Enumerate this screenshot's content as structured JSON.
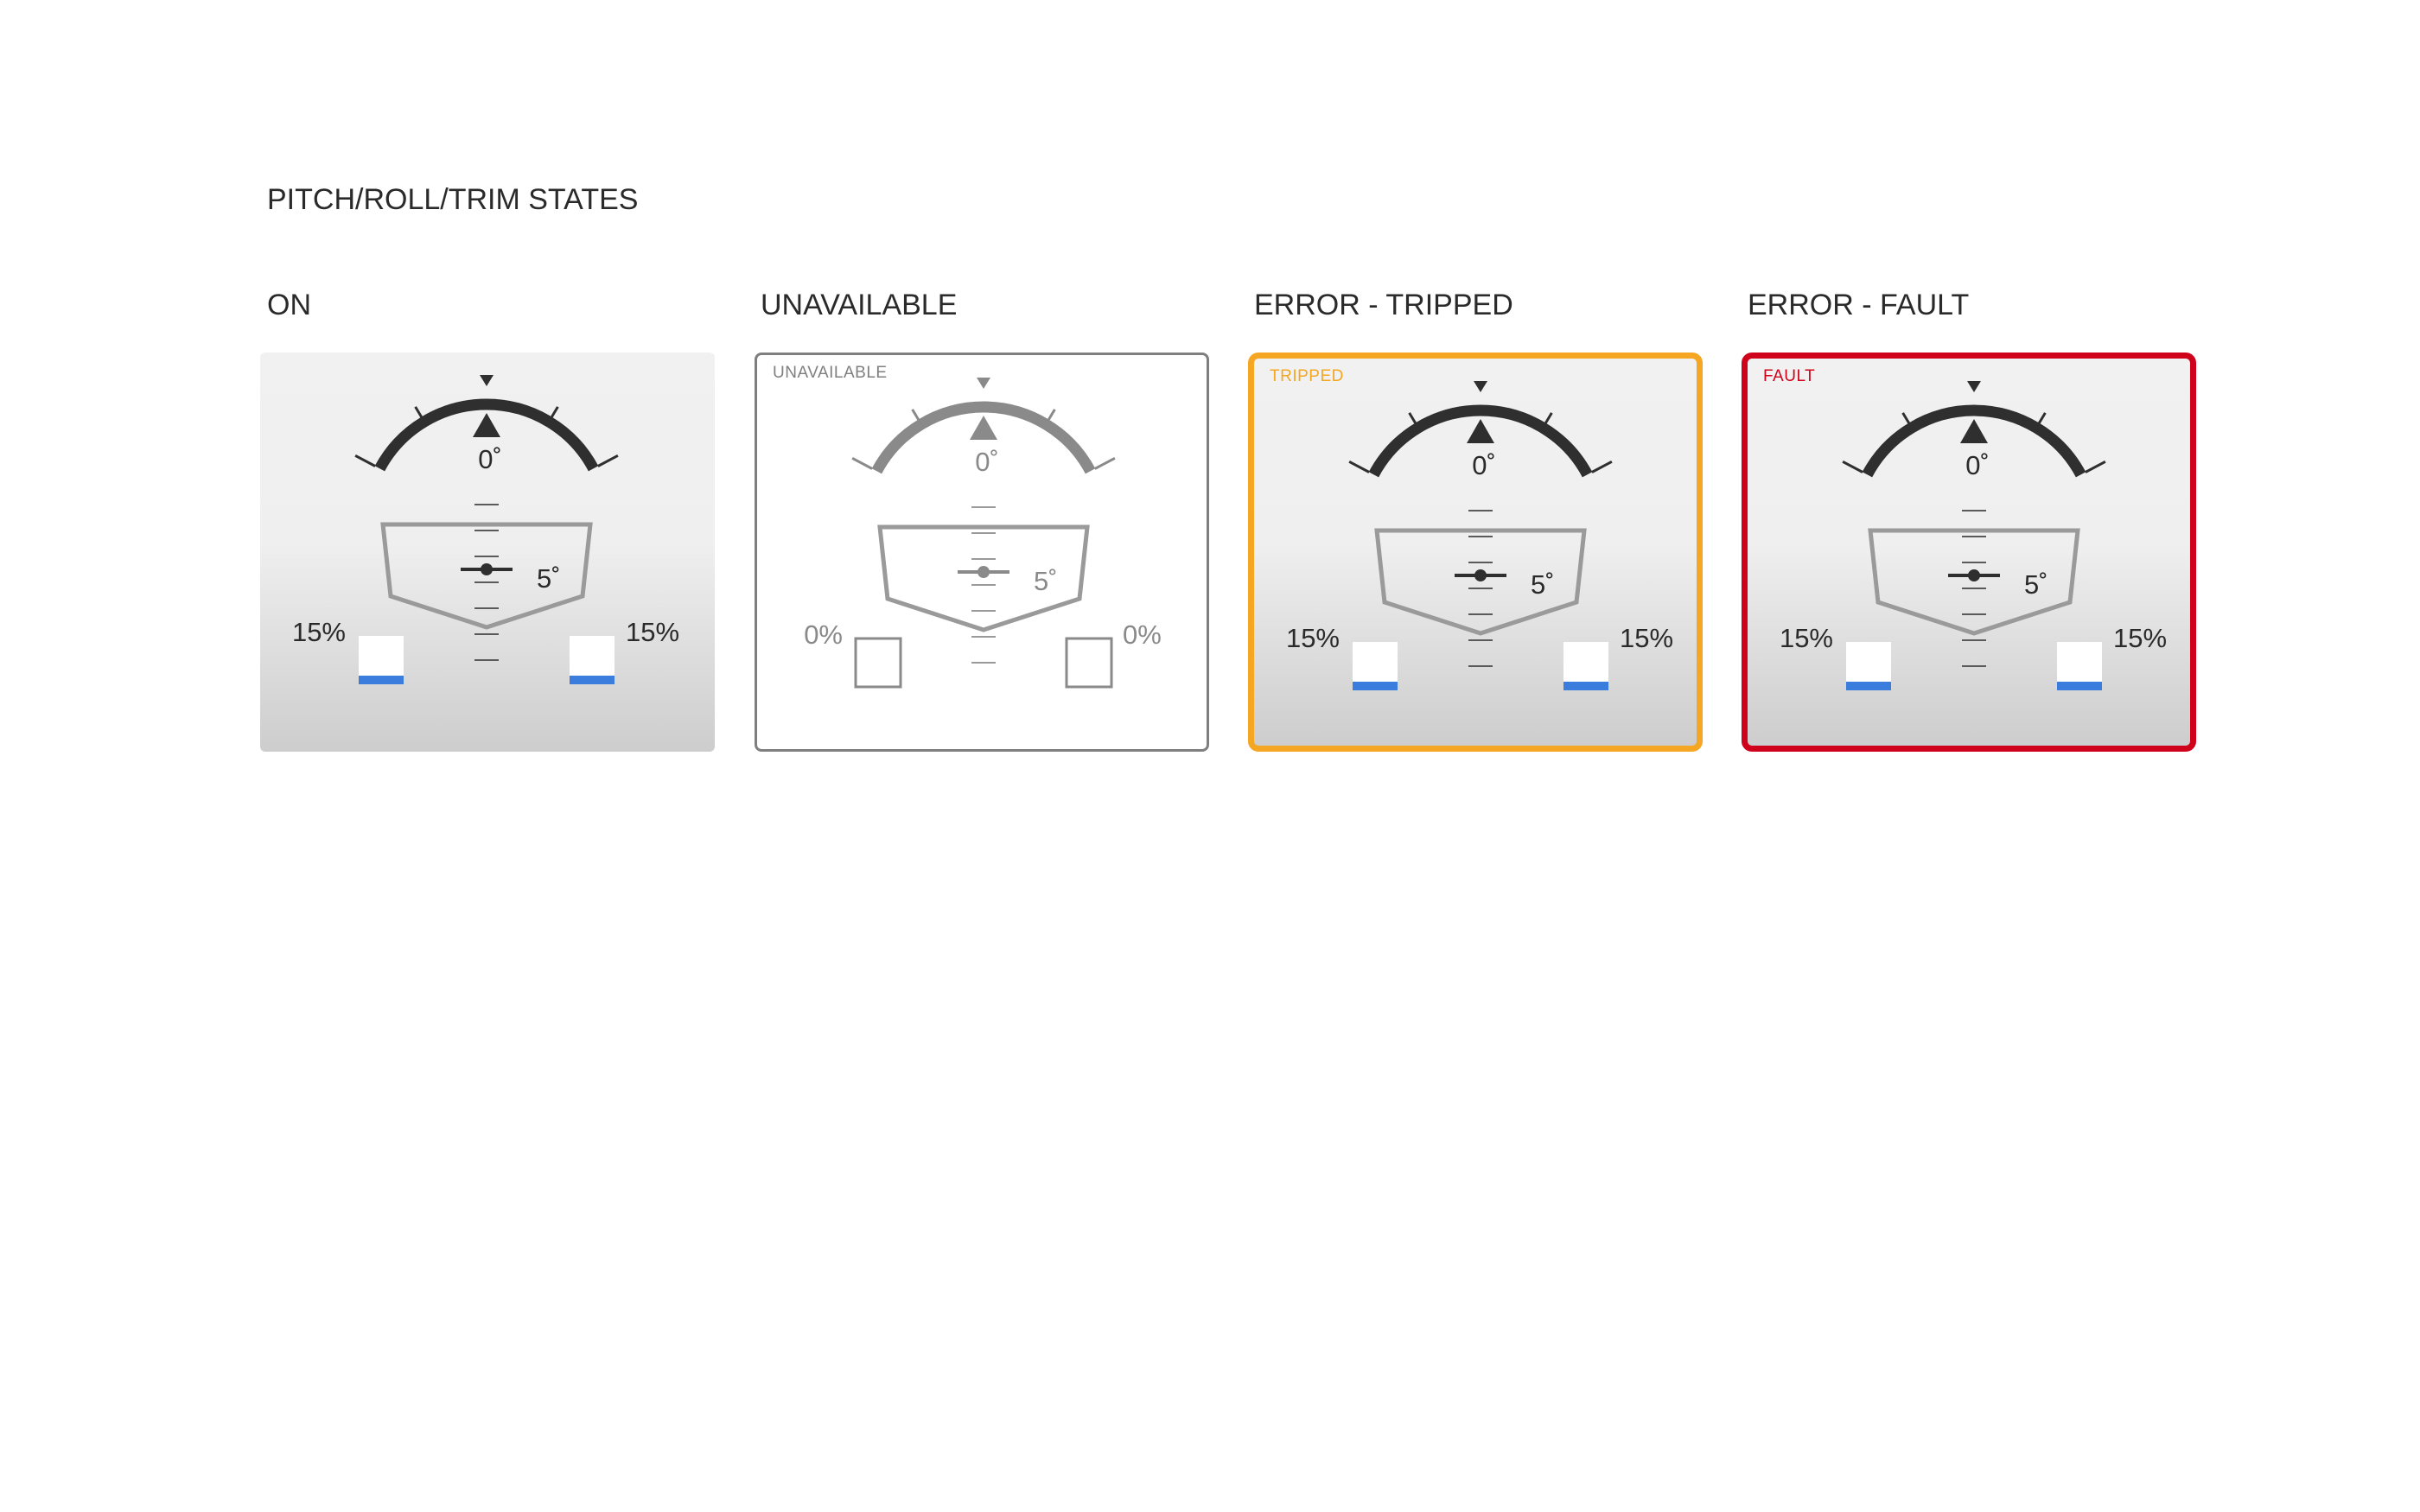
{
  "page": {
    "title": "PITCH/ROLL/TRIM STATES"
  },
  "colors": {
    "dark_arc": "#2f2f2f",
    "gray_arc": "#8a8a8a",
    "hull_outline": "#9a9a9a",
    "trim_fill": "#3b7ddd",
    "tripped": "#f5a623",
    "fault": "#d0021b",
    "unavailable_border": "#7f7f7f"
  },
  "states": [
    {
      "label": "ON",
      "badge": "",
      "roll": "0˚",
      "pitch": "5˚",
      "trim_left": "15%",
      "trim_right": "15%",
      "trim_left_level": 0.3,
      "trim_right_level": 0.3,
      "available": true
    },
    {
      "label": "UNAVAILABLE",
      "badge": "UNAVAILABLE",
      "roll": "0˚",
      "pitch": "5˚",
      "trim_left": "0%",
      "trim_right": "0%",
      "trim_left_level": 0,
      "trim_right_level": 0,
      "available": false
    },
    {
      "label": "ERROR - TRIPPED",
      "badge": "TRIPPED",
      "roll": "0˚",
      "pitch": "5˚",
      "trim_left": "15%",
      "trim_right": "15%",
      "trim_left_level": 0.3,
      "trim_right_level": 0.3,
      "available": true
    },
    {
      "label": "ERROR - FAULT",
      "badge": "FAULT",
      "roll": "0˚",
      "pitch": "5˚",
      "trim_left": "15%",
      "trim_right": "15%",
      "trim_left_level": 0.3,
      "trim_right_level": 0.3,
      "available": true
    }
  ]
}
